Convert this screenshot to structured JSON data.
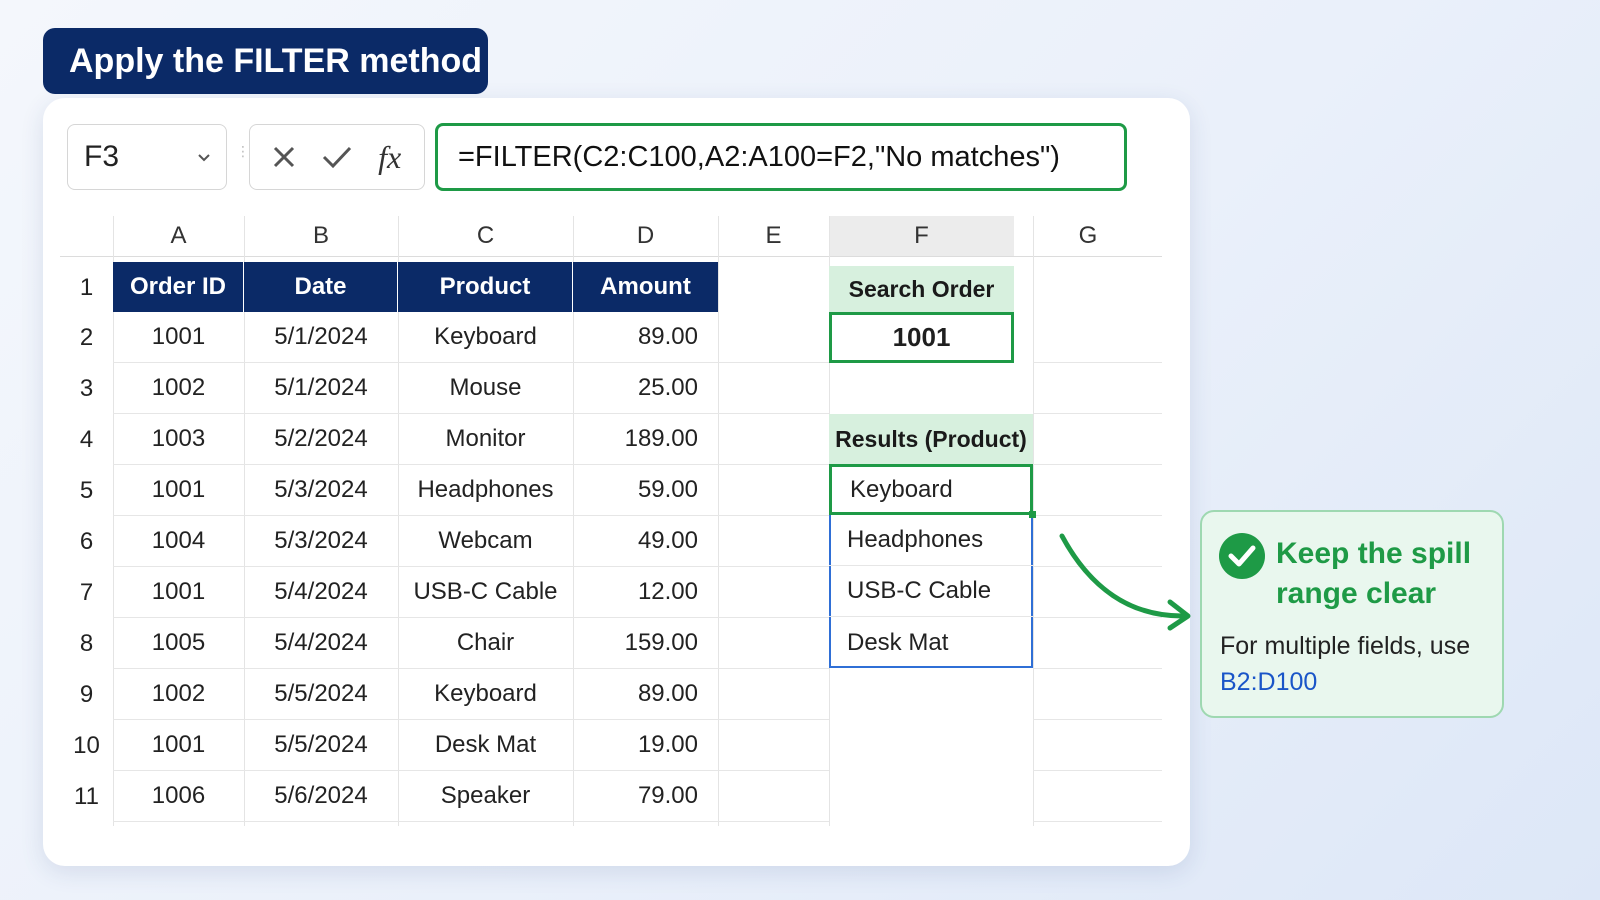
{
  "banner": {
    "title": "Apply the FILTER method"
  },
  "formula_bar": {
    "name_box": "F3",
    "formula": "=FILTER(C2:C100,A2:A100=F2,\"No matches\")"
  },
  "columns": [
    "A",
    "B",
    "C",
    "D",
    "E",
    "F",
    "G"
  ],
  "header_row": {
    "row": "1",
    "cells": [
      "Order ID",
      "Date",
      "Product",
      "Amount"
    ]
  },
  "rows": [
    {
      "row": "2",
      "cells": [
        "1001",
        "5/1/2024",
        "Keyboard",
        "89.00"
      ]
    },
    {
      "row": "3",
      "cells": [
        "1002",
        "5/1/2024",
        "Mouse",
        "25.00"
      ]
    },
    {
      "row": "4",
      "cells": [
        "1003",
        "5/2/2024",
        "Monitor",
        "189.00"
      ]
    },
    {
      "row": "5",
      "cells": [
        "1001",
        "5/3/2024",
        "Headphones",
        "59.00"
      ]
    },
    {
      "row": "6",
      "cells": [
        "1004",
        "5/3/2024",
        "Webcam",
        "49.00"
      ]
    },
    {
      "row": "7",
      "cells": [
        "1001",
        "5/4/2024",
        "USB-C Cable",
        "12.00"
      ]
    },
    {
      "row": "8",
      "cells": [
        "1005",
        "5/4/2024",
        "Chair",
        "159.00"
      ]
    },
    {
      "row": "9",
      "cells": [
        "1002",
        "5/5/2024",
        "Keyboard",
        "89.00"
      ]
    },
    {
      "row": "10",
      "cells": [
        "1001",
        "5/5/2024",
        "Desk Mat",
        "19.00"
      ]
    },
    {
      "row": "11",
      "cells": [
        "1006",
        "5/6/2024",
        "Speaker",
        "79.00"
      ]
    }
  ],
  "search": {
    "label": "Search Order",
    "value": "1001"
  },
  "results": {
    "label": "Results (Product)",
    "items": [
      "Keyboard",
      "Headphones",
      "USB-C Cable",
      "Desk Mat"
    ]
  },
  "tip": {
    "title": "Keep the spill range clear",
    "body_prefix": "For multiple fields, use",
    "body_range": "B2:D100"
  },
  "colors": {
    "navy": "#0b2a67",
    "green": "#1e9a46",
    "spill_blue": "#2f6fd6",
    "tip_bg": "#e9f7ee"
  }
}
